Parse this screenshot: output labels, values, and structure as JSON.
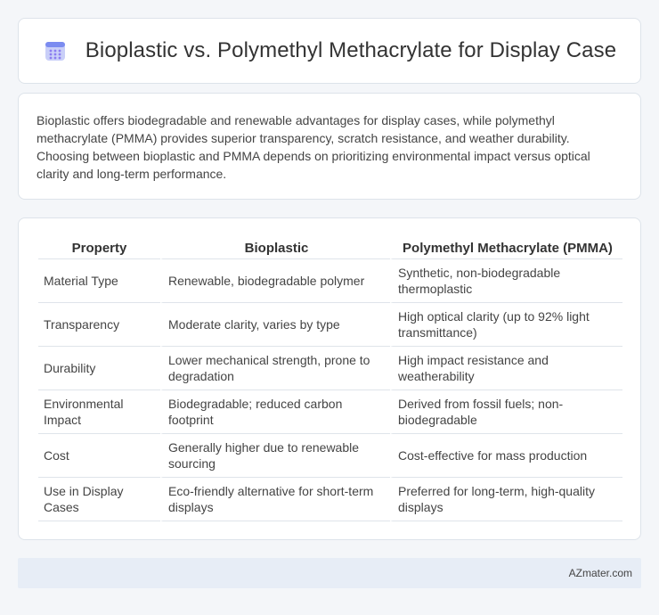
{
  "header": {
    "icon": "calendar-icon",
    "title": "Bioplastic vs. Polymethyl Methacrylate for Display Case"
  },
  "intro": {
    "text": "Bioplastic offers biodegradable and renewable advantages for display cases, while polymethyl methacrylate (PMMA) provides superior transparency, scratch resistance, and weather durability. Choosing between bioplastic and PMMA depends on prioritizing environmental impact versus optical clarity and long-term performance."
  },
  "table": {
    "headers": [
      "Property",
      "Bioplastic",
      "Polymethyl Methacrylate (PMMA)"
    ],
    "rows": [
      [
        "Material Type",
        "Renewable, biodegradable polymer",
        "Synthetic, non-biodegradable thermoplastic"
      ],
      [
        "Transparency",
        "Moderate clarity, varies by type",
        "High optical clarity (up to 92% light transmittance)"
      ],
      [
        "Durability",
        "Lower mechanical strength, prone to degradation",
        "High impact resistance and weatherability"
      ],
      [
        "Environmental Impact",
        "Biodegradable; reduced carbon footprint",
        "Derived from fossil fuels; non-biodegradable"
      ],
      [
        "Cost",
        "Generally higher due to renewable sourcing",
        "Cost-effective for mass production"
      ],
      [
        "Use in Display Cases",
        "Eco-friendly alternative for short-term displays",
        "Preferred for long-term, high-quality displays"
      ]
    ]
  },
  "footer": {
    "brand": "AZmater.com"
  },
  "colors": {
    "icon_top": "#7b8cf0",
    "icon_body": "#c9cff8",
    "icon_dots": "#8b7df0"
  }
}
